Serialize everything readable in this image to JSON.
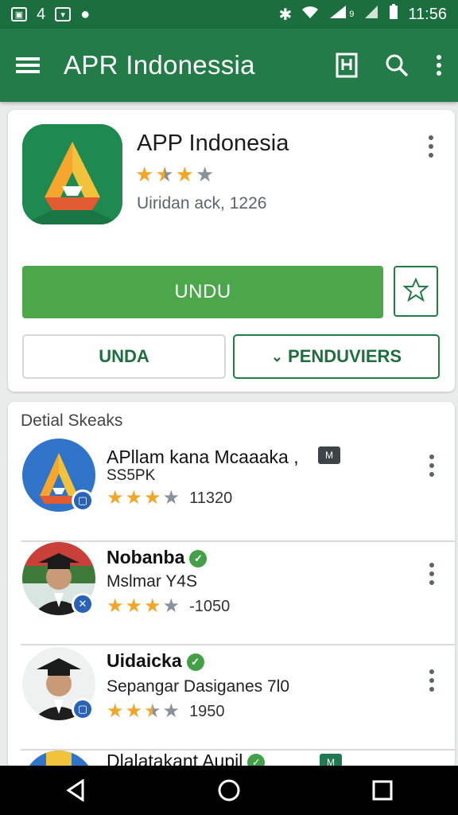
{
  "status_bar": {
    "left_number": "4",
    "time": "11:56",
    "signal_label": "9"
  },
  "app_bar": {
    "title": "APR Indonessia",
    "icons": [
      "menu-icon",
      "bookmark-icon",
      "search-icon",
      "more-vert-icon"
    ]
  },
  "app_card": {
    "name": "APP Indonesia",
    "rating_stars": 2.5,
    "subtitle": "Uiridan ack, 1226",
    "install_label": "UNDU",
    "secondary_label": "UNDA",
    "more_label": "PENDUVIERS",
    "more_chevron": "⌄"
  },
  "section": {
    "title": "Detial Skeaks",
    "items": [
      {
        "name": "APllam kana Mcaaaka ,",
        "sub": "SS5PK",
        "rating": 3,
        "count": "11320",
        "badge": "▢",
        "tag": "M",
        "verified": false
      },
      {
        "name": "Nobanba",
        "sub": "Mslmar Y4S",
        "rating": 3,
        "count": "-1050",
        "badge": "✕",
        "tag": "",
        "verified": true
      },
      {
        "name": "Uidaicka",
        "sub": "Sepangar Dasiganes 7l0",
        "rating": 2.5,
        "count": "1950",
        "badge": "▢",
        "tag": "",
        "verified": true
      },
      {
        "name": "Dlalatakant Aupil",
        "sub": "",
        "rating": 0,
        "count": "",
        "badge": "",
        "tag": "M",
        "verified": true
      }
    ]
  },
  "nav": {
    "icons": [
      "back-icon",
      "home-icon",
      "recents-icon"
    ]
  },
  "colors": {
    "primary": "#237b48",
    "status": "#1b6f3e",
    "install": "#4ca64a",
    "star": "#f1a627"
  }
}
